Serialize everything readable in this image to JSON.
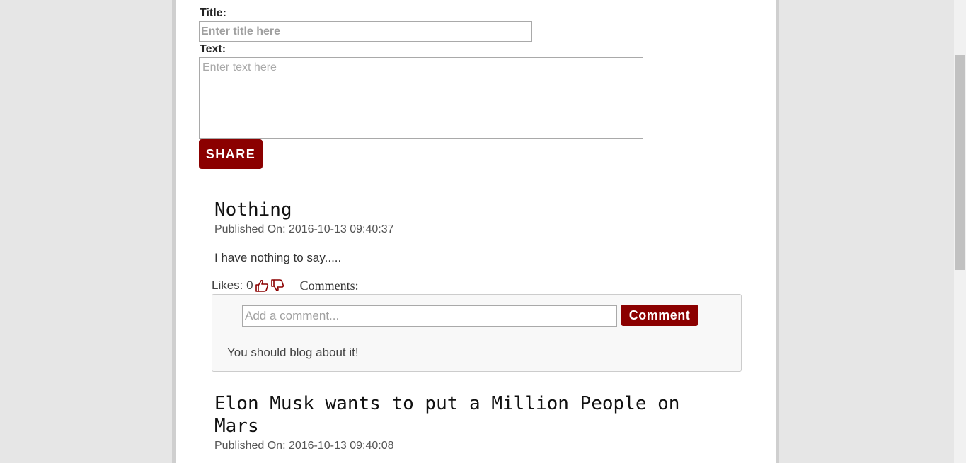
{
  "form": {
    "title_label": "Title:",
    "title_placeholder": "Enter title here",
    "text_label": "Text:",
    "text_placeholder": "Enter text here",
    "share_label": "SHARE"
  },
  "posts": [
    {
      "title": "Nothing",
      "published": "Published On: 2016-10-13 09:40:37",
      "body": "I have nothing to say.....",
      "likes_label": "Likes: 0",
      "comments_label": "Comments:",
      "comment_placeholder": "Add a comment...",
      "comment_button": "Comment",
      "comments": [
        "You should blog about it!"
      ]
    },
    {
      "title": "Elon Musk wants to put a Million People on Mars",
      "published": "Published On: 2016-10-13 09:40:08"
    }
  ],
  "icons": {
    "like": "thumbs-up-icon",
    "dislike": "thumbs-down-icon"
  },
  "colors": {
    "accent": "#8b0000",
    "background": "#e6e6e6"
  }
}
